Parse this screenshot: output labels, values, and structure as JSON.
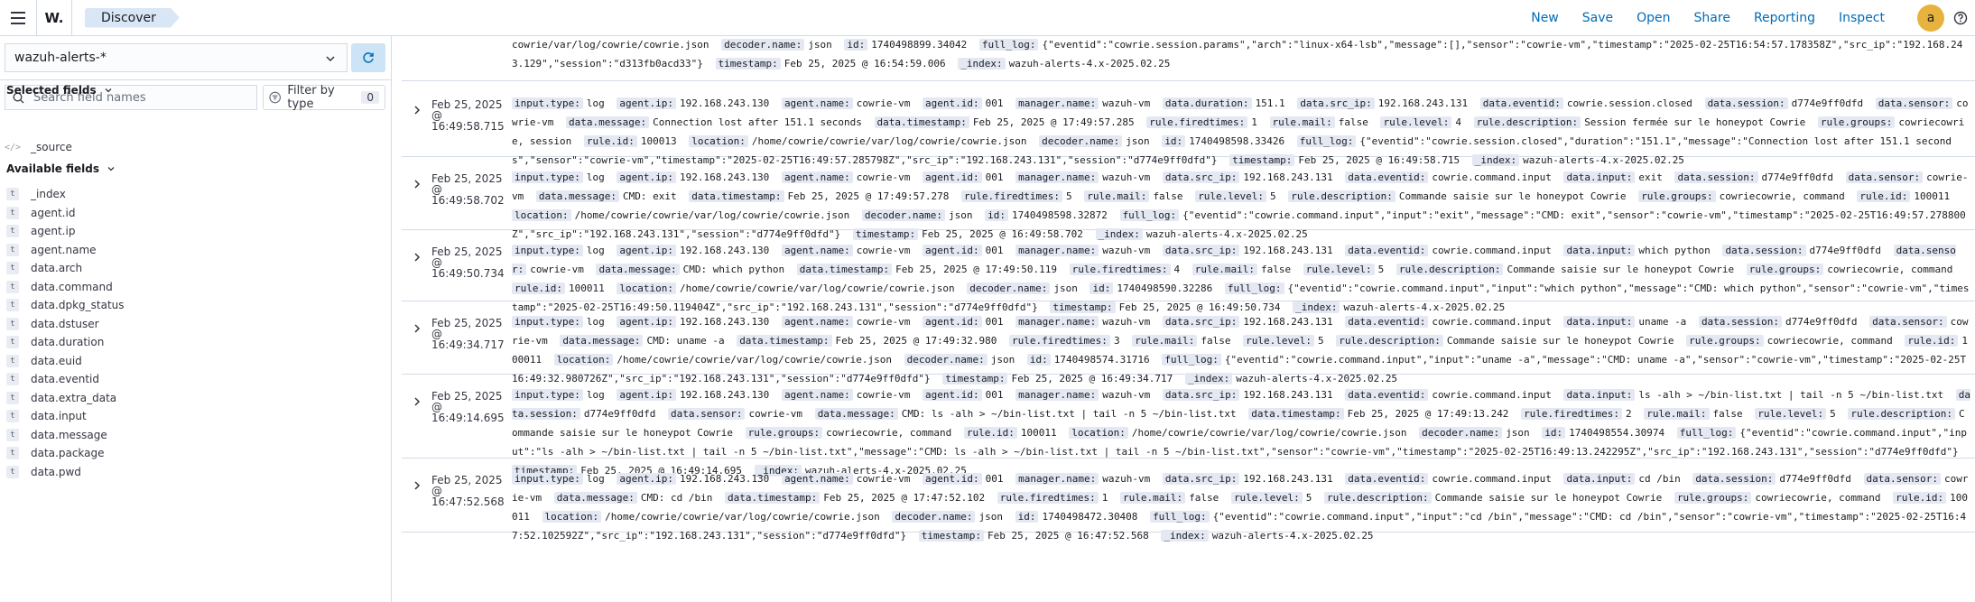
{
  "topbar": {
    "app_logo": "W.",
    "breadcrumb": "Discover",
    "menu": [
      "New",
      "Save",
      "Open",
      "Share",
      "Reporting",
      "Inspect"
    ],
    "avatar_letter": "a"
  },
  "sidebar": {
    "index_pattern": "wazuh-alerts-*",
    "search_placeholder": "Search field names",
    "filter_label": "Filter by type",
    "filter_count": "0",
    "selected_title": "Selected fields",
    "selected_fields": [
      {
        "type": "</>",
        "name": "_source"
      }
    ],
    "available_title": "Available fields",
    "available_fields": [
      {
        "type": "t",
        "name": "_index"
      },
      {
        "type": "t",
        "name": "agent.id"
      },
      {
        "type": "t",
        "name": "agent.ip"
      },
      {
        "type": "t",
        "name": "agent.name"
      },
      {
        "type": "t",
        "name": "data.arch"
      },
      {
        "type": "t",
        "name": "data.command"
      },
      {
        "type": "t",
        "name": "data.dpkg_status"
      },
      {
        "type": "t",
        "name": "data.dstuser"
      },
      {
        "type": "t",
        "name": "data.duration"
      },
      {
        "type": "t",
        "name": "data.euid"
      },
      {
        "type": "t",
        "name": "data.eventid"
      },
      {
        "type": "t",
        "name": "data.extra_data"
      },
      {
        "type": "t",
        "name": "data.input"
      },
      {
        "type": "t",
        "name": "data.message"
      },
      {
        "type": "t",
        "name": "data.package"
      },
      {
        "type": "t",
        "name": "data.pwd"
      }
    ]
  },
  "documents": [
    {
      "time": "",
      "partial": true,
      "fields": [
        [
          "",
          "cowrie/var/log/cowrie/cowrie.json"
        ],
        [
          "decoder.name:",
          "json"
        ],
        [
          "id:",
          "1740498899.34042"
        ],
        [
          "full_log:",
          "{\"eventid\":\"cowrie.session.params\",\"arch\":\"linux-x64-lsb\",\"message\":[],\"sensor\":\"cowrie-vm\",\"timestamp\":\"2025-02-25T16:54:57.178358Z\",\"src_ip\":\"192.168.243.129\",\"session\":\"d313fb0acd33\"}"
        ],
        [
          "timestamp:",
          "Feb 25, 2025 @ 16:54:59.006"
        ],
        [
          "_index:",
          "wazuh-alerts-4.x-2025.02.25"
        ]
      ]
    },
    {
      "time": "Feb 25, 2025 @ 16:49:58.715",
      "fields": [
        [
          "input.type:",
          "log"
        ],
        [
          "agent.ip:",
          "192.168.243.130"
        ],
        [
          "agent.name:",
          "cowrie-vm"
        ],
        [
          "agent.id:",
          "001"
        ],
        [
          "manager.name:",
          "wazuh-vm"
        ],
        [
          "data.duration:",
          "151.1"
        ],
        [
          "data.src_ip:",
          "192.168.243.131"
        ],
        [
          "data.eventid:",
          "cowrie.session.closed"
        ],
        [
          "data.session:",
          "d774e9ff0dfd"
        ],
        [
          "data.sensor:",
          "cowrie-vm"
        ],
        [
          "data.message:",
          "Connection lost after 151.1 seconds"
        ],
        [
          "data.timestamp:",
          "Feb 25, 2025 @ 17:49:57.285"
        ],
        [
          "rule.firedtimes:",
          "1"
        ],
        [
          "rule.mail:",
          "false"
        ],
        [
          "rule.level:",
          "4"
        ],
        [
          "rule.description:",
          "Session fermée sur le honeypot Cowrie"
        ],
        [
          "rule.groups:",
          "cowriecowrie, session"
        ],
        [
          "rule.id:",
          "100013"
        ],
        [
          "location:",
          "/home/cowrie/cowrie/var/log/cowrie/cowrie.json"
        ],
        [
          "decoder.name:",
          "json"
        ],
        [
          "id:",
          "1740498598.33426"
        ],
        [
          "full_log:",
          "{\"eventid\":\"cowrie.session.closed\",\"duration\":\"151.1\",\"message\":\"Connection lost after 151.1 seconds\",\"sensor\":\"cowrie-vm\",\"timestamp\":\"2025-02-25T16:49:57.285798Z\",\"src_ip\":\"192.168.243.131\",\"session\":\"d774e9ff0dfd\"}"
        ],
        [
          "timestamp:",
          "Feb 25, 2025 @ 16:49:58.715"
        ],
        [
          "_index:",
          "wazuh-alerts-4.x-2025.02.25"
        ]
      ]
    },
    {
      "time": "Feb 25, 2025 @ 16:49:58.702",
      "fields": [
        [
          "input.type:",
          "log"
        ],
        [
          "agent.ip:",
          "192.168.243.130"
        ],
        [
          "agent.name:",
          "cowrie-vm"
        ],
        [
          "agent.id:",
          "001"
        ],
        [
          "manager.name:",
          "wazuh-vm"
        ],
        [
          "data.src_ip:",
          "192.168.243.131"
        ],
        [
          "data.eventid:",
          "cowrie.command.input"
        ],
        [
          "data.input:",
          "exit"
        ],
        [
          "data.session:",
          "d774e9ff0dfd"
        ],
        [
          "data.sensor:",
          "cowrie-vm"
        ],
        [
          "data.message:",
          "CMD: exit"
        ],
        [
          "data.timestamp:",
          "Feb 25, 2025 @ 17:49:57.278"
        ],
        [
          "rule.firedtimes:",
          "5"
        ],
        [
          "rule.mail:",
          "false"
        ],
        [
          "rule.level:",
          "5"
        ],
        [
          "rule.description:",
          "Commande saisie sur le honeypot Cowrie"
        ],
        [
          "rule.groups:",
          "cowriecowrie, command"
        ],
        [
          "rule.id:",
          "100011"
        ],
        [
          "location:",
          "/home/cowrie/cowrie/var/log/cowrie/cowrie.json"
        ],
        [
          "decoder.name:",
          "json"
        ],
        [
          "id:",
          "1740498598.32872"
        ],
        [
          "full_log:",
          "{\"eventid\":\"cowrie.command.input\",\"input\":\"exit\",\"message\":\"CMD: exit\",\"sensor\":\"cowrie-vm\",\"timestamp\":\"2025-02-25T16:49:57.278800Z\",\"src_ip\":\"192.168.243.131\",\"session\":\"d774e9ff0dfd\"}"
        ],
        [
          "timestamp:",
          "Feb 25, 2025 @ 16:49:58.702"
        ],
        [
          "_index:",
          "wazuh-alerts-4.x-2025.02.25"
        ]
      ]
    },
    {
      "time": "Feb 25, 2025 @ 16:49:50.734",
      "fields": [
        [
          "input.type:",
          "log"
        ],
        [
          "agent.ip:",
          "192.168.243.130"
        ],
        [
          "agent.name:",
          "cowrie-vm"
        ],
        [
          "agent.id:",
          "001"
        ],
        [
          "manager.name:",
          "wazuh-vm"
        ],
        [
          "data.src_ip:",
          "192.168.243.131"
        ],
        [
          "data.eventid:",
          "cowrie.command.input"
        ],
        [
          "data.input:",
          "which python"
        ],
        [
          "data.session:",
          "d774e9ff0dfd"
        ],
        [
          "data.sensor:",
          "cowrie-vm"
        ],
        [
          "data.message:",
          "CMD: which python"
        ],
        [
          "data.timestamp:",
          "Feb 25, 2025 @ 17:49:50.119"
        ],
        [
          "rule.firedtimes:",
          "4"
        ],
        [
          "rule.mail:",
          "false"
        ],
        [
          "rule.level:",
          "5"
        ],
        [
          "rule.description:",
          "Commande saisie sur le honeypot Cowrie"
        ],
        [
          "rule.groups:",
          "cowriecowrie, command"
        ],
        [
          "rule.id:",
          "100011"
        ],
        [
          "location:",
          "/home/cowrie/cowrie/var/log/cowrie/cowrie.json"
        ],
        [
          "decoder.name:",
          "json"
        ],
        [
          "id:",
          "1740498590.32286"
        ],
        [
          "full_log:",
          "{\"eventid\":\"cowrie.command.input\",\"input\":\"which python\",\"message\":\"CMD: which python\",\"sensor\":\"cowrie-vm\",\"timestamp\":\"2025-02-25T16:49:50.119404Z\",\"src_ip\":\"192.168.243.131\",\"session\":\"d774e9ff0dfd\"}"
        ],
        [
          "timestamp:",
          "Feb 25, 2025 @ 16:49:50.734"
        ],
        [
          "_index:",
          "wazuh-alerts-4.x-2025.02.25"
        ]
      ]
    },
    {
      "time": "Feb 25, 2025 @ 16:49:34.717",
      "fields": [
        [
          "input.type:",
          "log"
        ],
        [
          "agent.ip:",
          "192.168.243.130"
        ],
        [
          "agent.name:",
          "cowrie-vm"
        ],
        [
          "agent.id:",
          "001"
        ],
        [
          "manager.name:",
          "wazuh-vm"
        ],
        [
          "data.src_ip:",
          "192.168.243.131"
        ],
        [
          "data.eventid:",
          "cowrie.command.input"
        ],
        [
          "data.input:",
          "uname -a"
        ],
        [
          "data.session:",
          "d774e9ff0dfd"
        ],
        [
          "data.sensor:",
          "cowrie-vm"
        ],
        [
          "data.message:",
          "CMD: uname -a"
        ],
        [
          "data.timestamp:",
          "Feb 25, 2025 @ 17:49:32.980"
        ],
        [
          "rule.firedtimes:",
          "3"
        ],
        [
          "rule.mail:",
          "false"
        ],
        [
          "rule.level:",
          "5"
        ],
        [
          "rule.description:",
          "Commande saisie sur le honeypot Cowrie"
        ],
        [
          "rule.groups:",
          "cowriecowrie, command"
        ],
        [
          "rule.id:",
          "100011"
        ],
        [
          "location:",
          "/home/cowrie/cowrie/var/log/cowrie/cowrie.json"
        ],
        [
          "decoder.name:",
          "json"
        ],
        [
          "id:",
          "1740498574.31716"
        ],
        [
          "full_log:",
          "{\"eventid\":\"cowrie.command.input\",\"input\":\"uname -a\",\"message\":\"CMD: uname -a\",\"sensor\":\"cowrie-vm\",\"timestamp\":\"2025-02-25T16:49:32.980726Z\",\"src_ip\":\"192.168.243.131\",\"session\":\"d774e9ff0dfd\"}"
        ],
        [
          "timestamp:",
          "Feb 25, 2025 @ 16:49:34.717"
        ],
        [
          "_index:",
          "wazuh-alerts-4.x-2025.02.25"
        ]
      ]
    },
    {
      "time": "Feb 25, 2025 @ 16:49:14.695",
      "fields": [
        [
          "input.type:",
          "log"
        ],
        [
          "agent.ip:",
          "192.168.243.130"
        ],
        [
          "agent.name:",
          "cowrie-vm"
        ],
        [
          "agent.id:",
          "001"
        ],
        [
          "manager.name:",
          "wazuh-vm"
        ],
        [
          "data.src_ip:",
          "192.168.243.131"
        ],
        [
          "data.eventid:",
          "cowrie.command.input"
        ],
        [
          "data.input:",
          "ls -alh > ~/bin-list.txt | tail -n 5 ~/bin-list.txt"
        ],
        [
          "data.session:",
          "d774e9ff0dfd"
        ],
        [
          "data.sensor:",
          "cowrie-vm"
        ],
        [
          "data.message:",
          "CMD: ls -alh > ~/bin-list.txt | tail -n 5 ~/bin-list.txt"
        ],
        [
          "data.timestamp:",
          "Feb 25, 2025 @ 17:49:13.242"
        ],
        [
          "rule.firedtimes:",
          "2"
        ],
        [
          "rule.mail:",
          "false"
        ],
        [
          "rule.level:",
          "5"
        ],
        [
          "rule.description:",
          "Commande saisie sur le honeypot Cowrie"
        ],
        [
          "rule.groups:",
          "cowriecowrie, command"
        ],
        [
          "rule.id:",
          "100011"
        ],
        [
          "location:",
          "/home/cowrie/cowrie/var/log/cowrie/cowrie.json"
        ],
        [
          "decoder.name:",
          "json"
        ],
        [
          "id:",
          "1740498554.30974"
        ],
        [
          "full_log:",
          "{\"eventid\":\"cowrie.command.input\",\"input\":\"ls -alh > ~/bin-list.txt | tail -n 5 ~/bin-list.txt\",\"message\":\"CMD: ls -alh > ~/bin-list.txt | tail -n 5 ~/bin-list.txt\",\"sensor\":\"cowrie-vm\",\"timestamp\":\"2025-02-25T16:49:13.242295Z\",\"src_ip\":\"192.168.243.131\",\"session\":\"d774e9ff0dfd\"}"
        ],
        [
          "timestamp:",
          "Feb 25, 2025 @ 16:49:14.695"
        ],
        [
          "_index:",
          "wazuh-alerts-4.x-2025.02.25"
        ]
      ]
    },
    {
      "time": "Feb 25, 2025 @ 16:47:52.568",
      "fields": [
        [
          "input.type:",
          "log"
        ],
        [
          "agent.ip:",
          "192.168.243.130"
        ],
        [
          "agent.name:",
          "cowrie-vm"
        ],
        [
          "agent.id:",
          "001"
        ],
        [
          "manager.name:",
          "wazuh-vm"
        ],
        [
          "data.src_ip:",
          "192.168.243.131"
        ],
        [
          "data.eventid:",
          "cowrie.command.input"
        ],
        [
          "data.input:",
          "cd /bin"
        ],
        [
          "data.session:",
          "d774e9ff0dfd"
        ],
        [
          "data.sensor:",
          "cowrie-vm"
        ],
        [
          "data.message:",
          "CMD: cd /bin"
        ],
        [
          "data.timestamp:",
          "Feb 25, 2025 @ 17:47:52.102"
        ],
        [
          "rule.firedtimes:",
          "1"
        ],
        [
          "rule.mail:",
          "false"
        ],
        [
          "rule.level:",
          "5"
        ],
        [
          "rule.description:",
          "Commande saisie sur le honeypot Cowrie"
        ],
        [
          "rule.groups:",
          "cowriecowrie, command"
        ],
        [
          "rule.id:",
          "100011"
        ],
        [
          "location:",
          "/home/cowrie/cowrie/var/log/cowrie/cowrie.json"
        ],
        [
          "decoder.name:",
          "json"
        ],
        [
          "id:",
          "1740498472.30408"
        ],
        [
          "full_log:",
          "{\"eventid\":\"cowrie.command.input\",\"input\":\"cd /bin\",\"message\":\"CMD: cd /bin\",\"sensor\":\"cowrie-vm\",\"timestamp\":\"2025-02-25T16:47:52.102592Z\",\"src_ip\":\"192.168.243.131\",\"session\":\"d774e9ff0dfd\"}"
        ],
        [
          "timestamp:",
          "Feb 25, 2025 @ 16:47:52.568"
        ],
        [
          "_index:",
          "wazuh-alerts-4.x-2025.02.25"
        ]
      ]
    }
  ]
}
